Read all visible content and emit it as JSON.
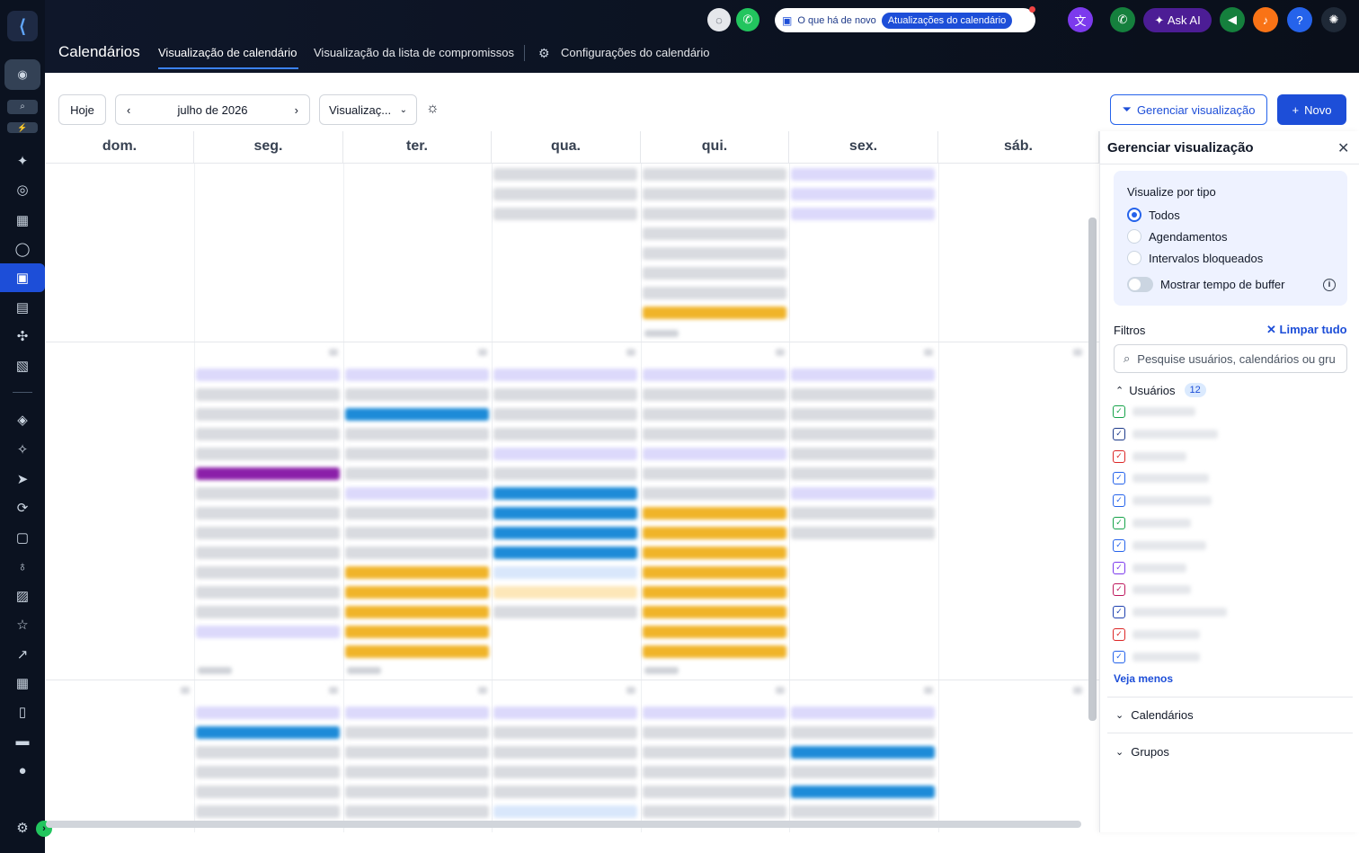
{
  "header": {
    "app_title": "Calendários",
    "tabs": [
      {
        "label": "Visualização de calendário",
        "active": true
      },
      {
        "label": "Visualização da lista de compromissos",
        "active": false
      },
      {
        "label": "Configurações do calendário",
        "active": false
      }
    ],
    "whats_new_label": "O que há de novo",
    "updates_badge": "Atualizações do calendário",
    "ask_ai_label": "Ask AI",
    "help_label": "?"
  },
  "toolbar": {
    "today_label": "Hoje",
    "month_label": "julho de 2026",
    "view_select_label": "Visualizaç...",
    "manage_view_label": "Gerenciar visualização",
    "new_label": "Novo"
  },
  "calendar": {
    "weekdays": [
      "dom.",
      "seg.",
      "ter.",
      "qua.",
      "qui.",
      "sex.",
      "sáb."
    ]
  },
  "panel": {
    "title": "Gerenciar visualização",
    "view_by_type_label": "Visualize por tipo",
    "type_options": [
      "Todos",
      "Agendamentos",
      "Intervalos bloqueados"
    ],
    "selected_type": "Todos",
    "buffer_toggle_label": "Mostrar tempo de buffer",
    "buffer_toggle_on": false,
    "filters_label": "Filtros",
    "clear_all_label": "Limpar tudo",
    "search_placeholder": "Pesquise usuários, calendários ou grupos",
    "users_label": "Usuários",
    "users_count": "12",
    "user_check_colors": [
      "#16a34a",
      "#1e3a8a",
      "#dc2626",
      "#2563eb",
      "#2563eb",
      "#16a34a",
      "#2563eb",
      "#7c3aed",
      "#be185d",
      "#1e40af",
      "#dc2626",
      "#2563eb"
    ],
    "see_less_label": "Veja menos",
    "calendars_label": "Calendários",
    "groups_label": "Grupos"
  },
  "colors": {
    "accent": "#1d4ed8",
    "sidebar_bg": "#0b1220",
    "event_blue": "#1d8bd8",
    "event_yellow": "#f0b429",
    "event_purple": "#8b1fa9",
    "event_lavender": "#dcd9fb"
  }
}
